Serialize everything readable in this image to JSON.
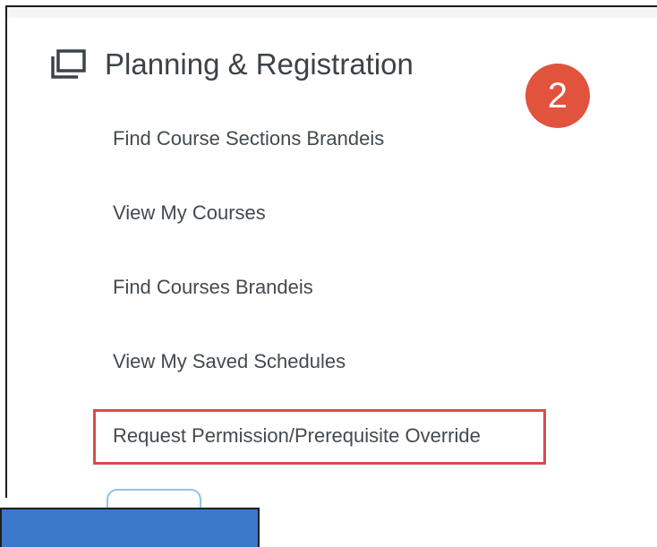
{
  "section": {
    "title": "Planning & Registration",
    "icon": "window-stack-icon"
  },
  "step_badge": "2",
  "menu": {
    "items": [
      {
        "label": "Find Course Sections Brandeis"
      },
      {
        "label": "View My Courses"
      },
      {
        "label": "Find Courses Brandeis"
      },
      {
        "label": "View My Saved Schedules"
      },
      {
        "label": "Request Permission/Prerequisite Override"
      }
    ]
  },
  "colors": {
    "badge": "#e1533c",
    "highlight_border": "#d94c4c",
    "bottom_bar": "#3a78c9",
    "text": "#424a50"
  }
}
